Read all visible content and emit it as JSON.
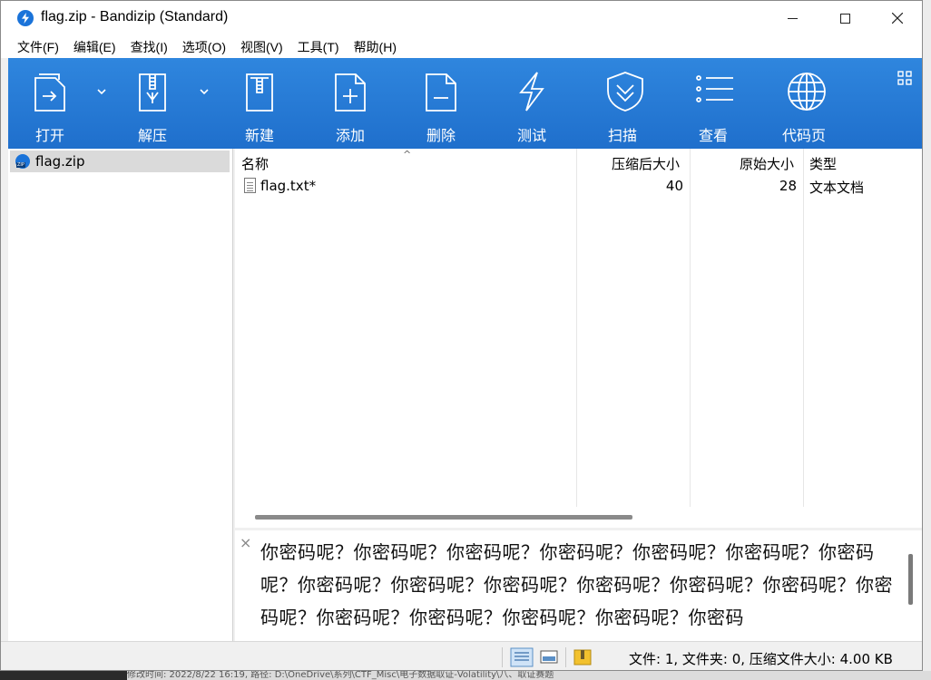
{
  "window": {
    "title": "flag.zip - Bandizip (Standard)"
  },
  "menu": [
    "文件(F)",
    "编辑(E)",
    "查找(I)",
    "选项(O)",
    "视图(V)",
    "工具(T)",
    "帮助(H)"
  ],
  "toolbar": [
    {
      "label": "打开",
      "icon": "open-icon"
    },
    {
      "label": "解压",
      "icon": "extract-icon"
    },
    {
      "label": "新建",
      "icon": "new-archive-icon"
    },
    {
      "label": "添加",
      "icon": "add-icon"
    },
    {
      "label": "删除",
      "icon": "delete-icon"
    },
    {
      "label": "测试",
      "icon": "test-icon"
    },
    {
      "label": "扫描",
      "icon": "scan-icon"
    },
    {
      "label": "查看",
      "icon": "view-icon"
    },
    {
      "label": "代码页",
      "icon": "codepage-icon"
    }
  ],
  "tree": {
    "item": "flag.zip"
  },
  "list": {
    "columns": [
      "名称",
      "压缩后大小",
      "原始大小",
      "类型"
    ],
    "rows": [
      {
        "name": "flag.txt*",
        "compressed": "40",
        "original": "28",
        "type": "文本文档"
      }
    ]
  },
  "preview": {
    "text": "你密码呢？你密码呢？你密码呢？你密码呢？你密码呢？你密码呢？你密码呢？你密码呢？你密码呢？你密码呢？你密码呢？你密码呢？你密码呢？你密码呢？你密码呢？你密码呢？你密码呢？你密码呢？你密码"
  },
  "status": {
    "text": "文件: 1, 文件夹: 0, 压缩文件大小: 4.00 KB"
  },
  "background_path_text": "修改时间: 2022/8/22 16:19, 路径: D:\\OneDrive\\系列\\CTF_Misc\\电子数据取证-Volatility\\八、取证赛题",
  "colors": {
    "toolbar": "#2679d4",
    "selection": "#dadada"
  }
}
